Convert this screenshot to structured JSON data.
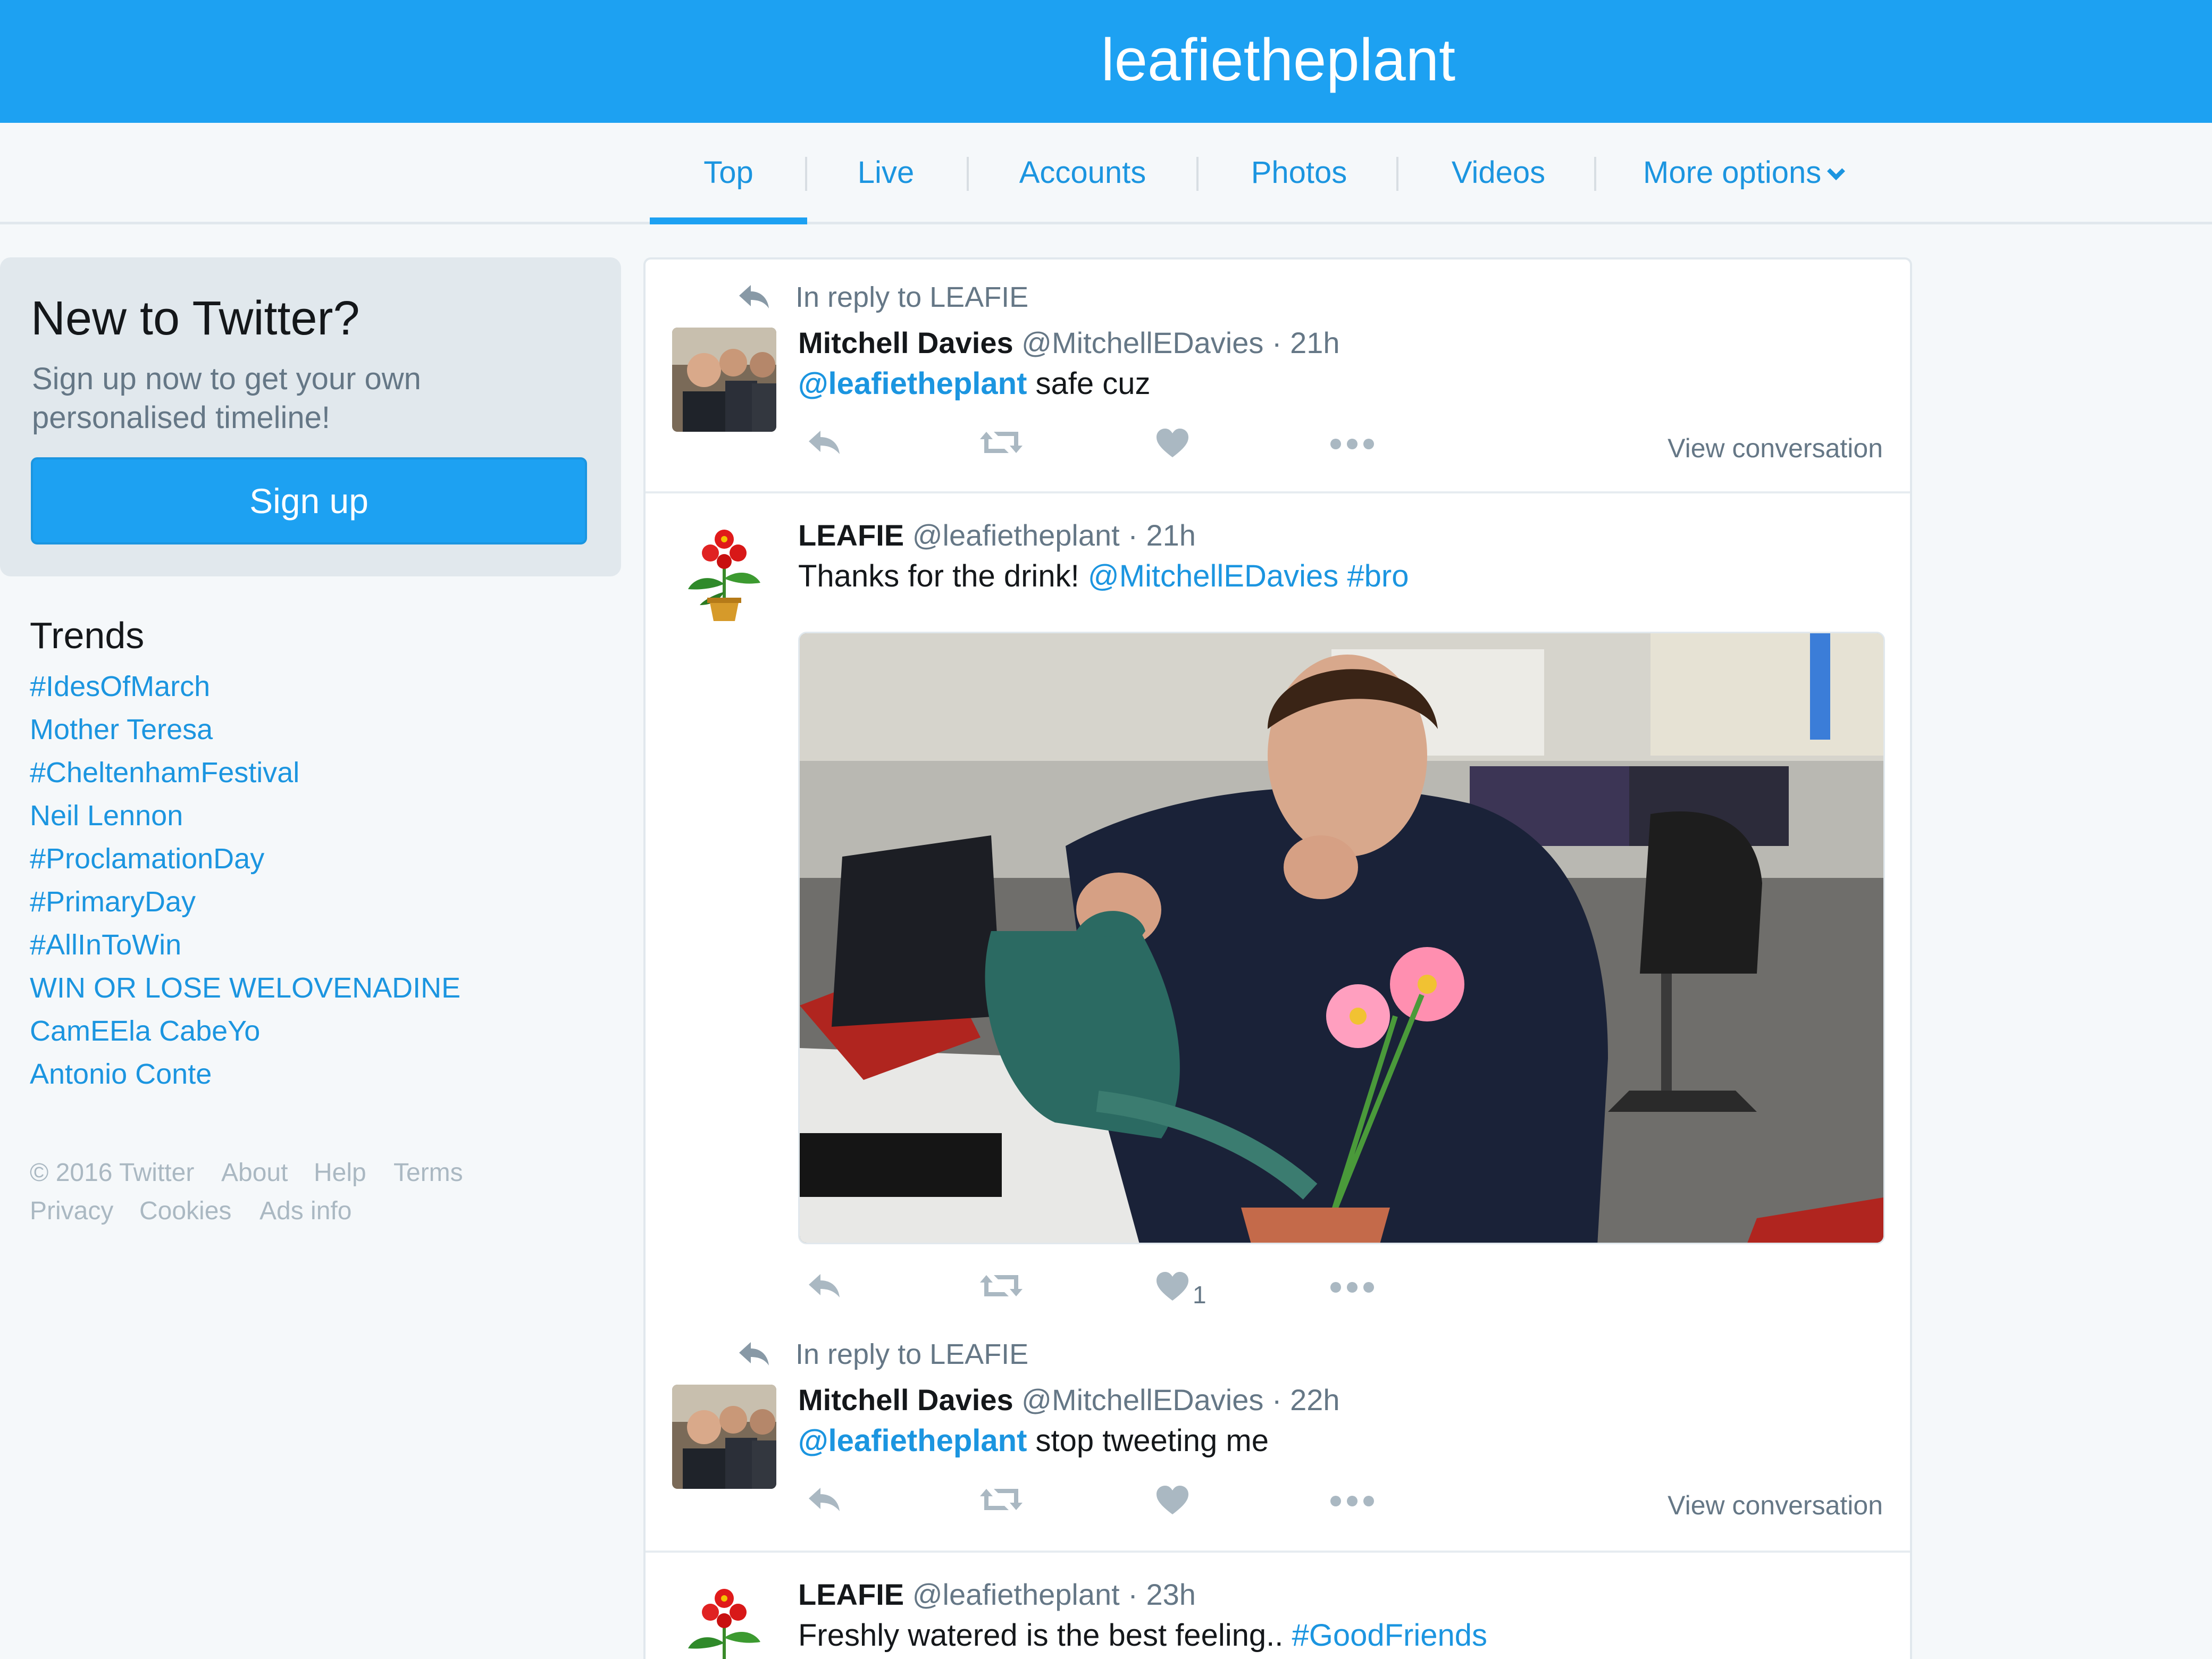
{
  "header": {
    "title": "leafietheplant"
  },
  "nav": {
    "tabs": [
      {
        "label": "Top"
      },
      {
        "label": "Live"
      },
      {
        "label": "Accounts"
      },
      {
        "label": "Photos"
      },
      {
        "label": "Videos"
      },
      {
        "label": "More options"
      }
    ]
  },
  "signup": {
    "heading": "New to Twitter?",
    "text": "Sign up now to get your own personalised timeline!",
    "button": "Sign up"
  },
  "trends": {
    "heading": "Trends",
    "items": [
      "#IdesOfMarch",
      "Mother Teresa",
      "#CheltenhamFestival",
      "Neil Lennon",
      "#ProclamationDay",
      "#PrimaryDay",
      "#AllInToWin",
      "WIN OR LOSE WELOVENADINE",
      "CamEEla CabeYo",
      "Antonio Conte"
    ]
  },
  "footer": {
    "links": [
      "© 2016 Twitter",
      "About",
      "Help",
      "Terms",
      "Privacy",
      "Cookies",
      "Ads info"
    ]
  },
  "tweets": [
    {
      "reply_to": "In reply to LEAFIE",
      "name": "Mitchell Davies",
      "meta": "@MitchellEDavies · 21h",
      "mention": "@leafietheplant",
      "text": " safe cuz",
      "view_conversation": "View conversation"
    },
    {
      "name": "LEAFIE",
      "meta": "@leafietheplant · 21h",
      "text": "Thanks for the drink! ",
      "mention": "@MitchellEDavies",
      "hashtag": " #bro",
      "like_count": "1"
    },
    {
      "reply_to": "In reply to LEAFIE",
      "name": "Mitchell Davies",
      "meta": "@MitchellEDavies · 22h",
      "mention": "@leafietheplant",
      "text": " stop tweeting me",
      "view_conversation": "View conversation"
    },
    {
      "name": "LEAFIE",
      "meta": "@leafietheplant · 23h",
      "text": "Freshly watered is the best feeling.. ",
      "hashtag": "#GoodFriends"
    }
  ],
  "colors": {
    "brand": "#1da1f2",
    "link": "#1b95e0",
    "muted": "#657786",
    "icon": "#aab8c2"
  },
  "icons": [
    "reply-icon",
    "retweet-icon",
    "heart-icon",
    "more-icon",
    "chevron-down-icon"
  ]
}
